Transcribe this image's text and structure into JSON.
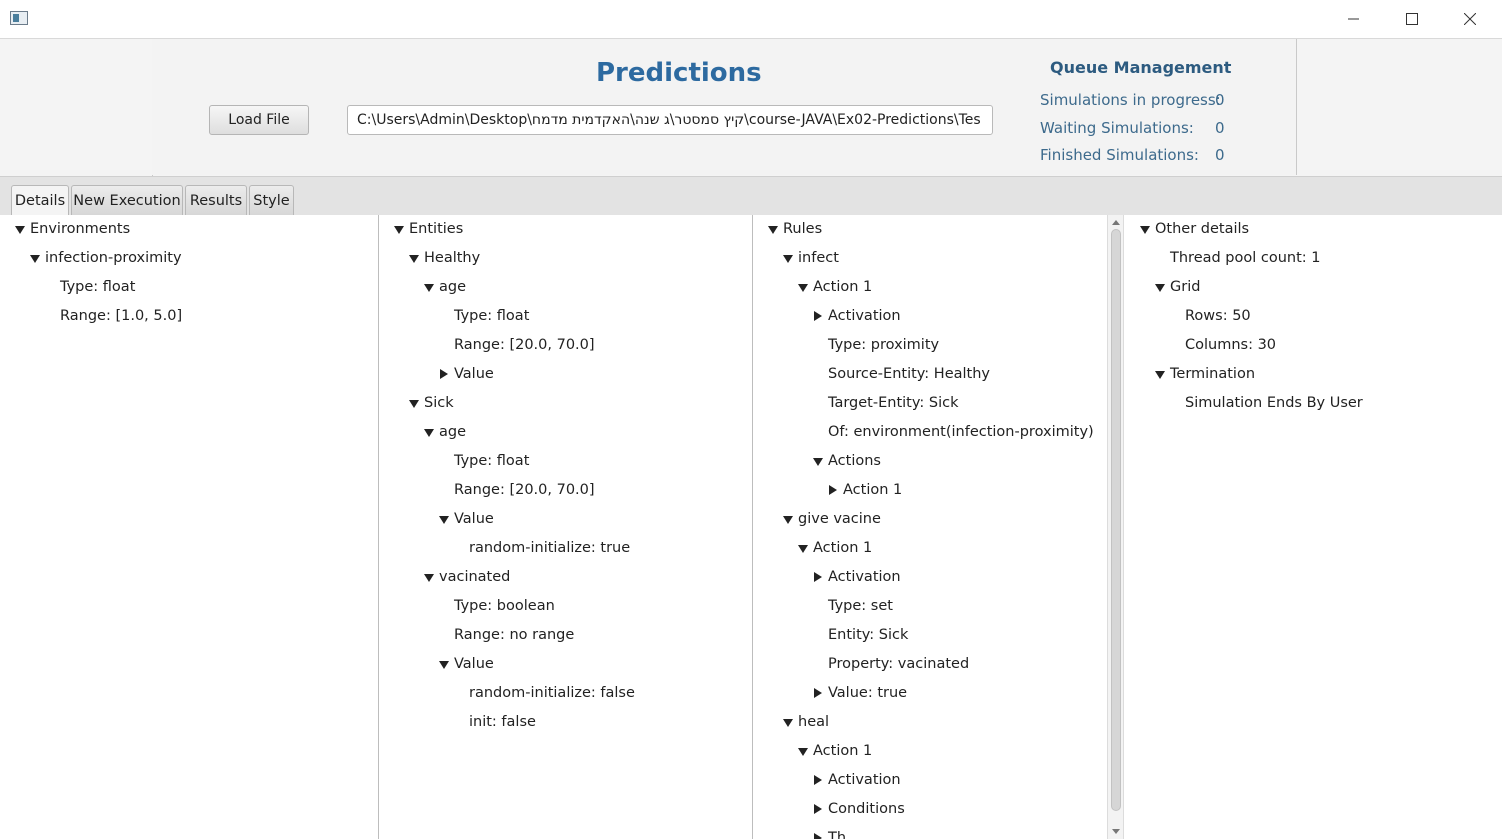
{
  "window": {
    "icon": "app-window-icon",
    "controls": [
      "minimize-icon",
      "maximize-icon",
      "close-icon"
    ]
  },
  "header": {
    "title": "Predictions",
    "load_button": "Load File",
    "file_path": "C:\\Users\\Admin\\Desktop\\קיץ סמסטר\\ג שנה\\האקדמית מדמח\\course-JAVA\\Ex02-Predictions\\Tes"
  },
  "queue": {
    "title": "Queue Management",
    "in_progress_label": "Simulations in progress:",
    "in_progress_value": "0",
    "waiting_label": "Waiting Simulations:",
    "waiting_value": "0",
    "finished_label": "Finished Simulations:",
    "finished_value": "0"
  },
  "tabs": [
    {
      "label": "Details",
      "selected": true
    },
    {
      "label": "New Execution",
      "selected": false
    },
    {
      "label": "Results",
      "selected": false
    },
    {
      "label": "Style",
      "selected": false
    }
  ],
  "trees": {
    "environments": [
      {
        "text": "Environments",
        "level": 0,
        "arrow": "down"
      },
      {
        "text": "infection-proximity",
        "level": 1,
        "arrow": "down"
      },
      {
        "text": "Type: float",
        "level": 2,
        "arrow": ""
      },
      {
        "text": "Range: [1.0, 5.0]",
        "level": 2,
        "arrow": ""
      }
    ],
    "entities": [
      {
        "text": "Entities",
        "level": 0,
        "arrow": "down"
      },
      {
        "text": "Healthy",
        "level": 1,
        "arrow": "down"
      },
      {
        "text": "age",
        "level": 2,
        "arrow": "down"
      },
      {
        "text": "Type: float",
        "level": 3,
        "arrow": ""
      },
      {
        "text": "Range: [20.0, 70.0]",
        "level": 3,
        "arrow": ""
      },
      {
        "text": "Value",
        "level": 3,
        "arrow": "right"
      },
      {
        "text": "Sick",
        "level": 1,
        "arrow": "down"
      },
      {
        "text": "age",
        "level": 2,
        "arrow": "down"
      },
      {
        "text": "Type: float",
        "level": 3,
        "arrow": ""
      },
      {
        "text": "Range: [20.0, 70.0]",
        "level": 3,
        "arrow": ""
      },
      {
        "text": "Value",
        "level": 3,
        "arrow": "down"
      },
      {
        "text": "random-initialize: true",
        "level": 4,
        "arrow": ""
      },
      {
        "text": "vacinated",
        "level": 2,
        "arrow": "down"
      },
      {
        "text": "Type: boolean",
        "level": 3,
        "arrow": ""
      },
      {
        "text": "Range: no range",
        "level": 3,
        "arrow": ""
      },
      {
        "text": "Value",
        "level": 3,
        "arrow": "down"
      },
      {
        "text": "random-initialize: false",
        "level": 4,
        "arrow": ""
      },
      {
        "text": "init: false",
        "level": 4,
        "arrow": ""
      }
    ],
    "rules": [
      {
        "text": "Rules",
        "level": 0,
        "arrow": "down"
      },
      {
        "text": "infect",
        "level": 1,
        "arrow": "down"
      },
      {
        "text": "Action 1",
        "level": 2,
        "arrow": "down"
      },
      {
        "text": "Activation",
        "level": 3,
        "arrow": "right"
      },
      {
        "text": "Type: proximity",
        "level": 3,
        "arrow": ""
      },
      {
        "text": "Source-Entity: Healthy",
        "level": 3,
        "arrow": ""
      },
      {
        "text": "Target-Entity: Sick",
        "level": 3,
        "arrow": ""
      },
      {
        "text": "Of: environment(infection-proximity)",
        "level": 3,
        "arrow": ""
      },
      {
        "text": "Actions",
        "level": 3,
        "arrow": "down"
      },
      {
        "text": "Action 1",
        "level": 4,
        "arrow": "right"
      },
      {
        "text": "give vacine",
        "level": 1,
        "arrow": "down"
      },
      {
        "text": "Action 1",
        "level": 2,
        "arrow": "down"
      },
      {
        "text": "Activation",
        "level": 3,
        "arrow": "right"
      },
      {
        "text": "Type: set",
        "level": 3,
        "arrow": ""
      },
      {
        "text": "Entity: Sick",
        "level": 3,
        "arrow": ""
      },
      {
        "text": "Property: vacinated",
        "level": 3,
        "arrow": ""
      },
      {
        "text": "Value: true",
        "level": 3,
        "arrow": "right"
      },
      {
        "text": "heal",
        "level": 1,
        "arrow": "down"
      },
      {
        "text": "Action 1",
        "level": 2,
        "arrow": "down"
      },
      {
        "text": "Activation",
        "level": 3,
        "arrow": "right"
      },
      {
        "text": "Conditions",
        "level": 3,
        "arrow": "right"
      },
      {
        "text": "Th",
        "level": 3,
        "arrow": "right"
      }
    ],
    "other": [
      {
        "text": "Other details",
        "level": 0,
        "arrow": "down"
      },
      {
        "text": "Thread pool count: 1",
        "level": 1,
        "arrow": ""
      },
      {
        "text": "Grid",
        "level": 1,
        "arrow": "down"
      },
      {
        "text": "Rows: 50",
        "level": 2,
        "arrow": ""
      },
      {
        "text": "Columns: 30",
        "level": 2,
        "arrow": ""
      },
      {
        "text": "Termination",
        "level": 1,
        "arrow": "down"
      },
      {
        "text": "Simulation Ends By User",
        "level": 2,
        "arrow": ""
      }
    ]
  },
  "scrollbar": {
    "icons": [
      "scroll-up-icon",
      "scroll-down-icon"
    ]
  }
}
